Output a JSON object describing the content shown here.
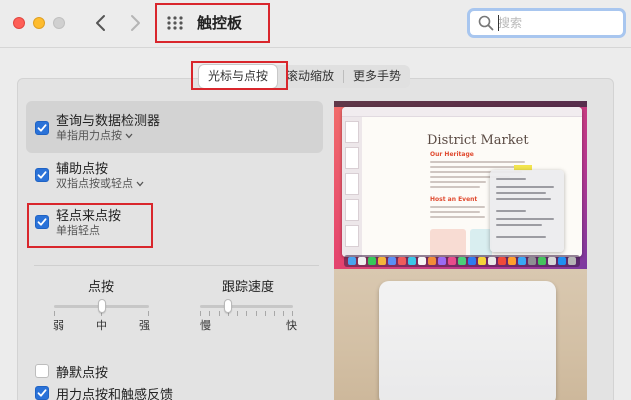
{
  "window": {
    "title": "触控板",
    "search_placeholder": "搜索"
  },
  "tabs": [
    {
      "label": "光标与点按",
      "active": true
    },
    {
      "label": "滚动缩放",
      "active": false
    },
    {
      "label": "更多手势",
      "active": false
    }
  ],
  "options": [
    {
      "title": "查询与数据检测器",
      "subtitle": "单指用力点按",
      "checked": true,
      "has_menu": true
    },
    {
      "title": "辅助点按",
      "subtitle": "双指点按或轻点",
      "checked": true,
      "has_menu": true
    },
    {
      "title": "轻点来点按",
      "subtitle": "单指轻点",
      "checked": true,
      "has_menu": false
    }
  ],
  "sliders": {
    "click": {
      "label": "点按",
      "min_label": "弱",
      "mid_label": "中",
      "max_label": "强",
      "level": 0.5
    },
    "speed": {
      "label": "跟踪速度",
      "min_label": "慢",
      "max_label": "快",
      "level": 0.3
    }
  },
  "bottom_options": [
    {
      "label": "静默点按",
      "checked": false
    },
    {
      "label": "用力点按和触感反馈",
      "checked": true
    }
  ],
  "preview": {
    "doc_title": "District Market",
    "heading_1": "Our Heritage",
    "heading_2": "Host an Event"
  },
  "colors": {
    "accent": "#2a72d8",
    "annotation": "#d9262c",
    "search_focus": "#a8c6ef"
  }
}
